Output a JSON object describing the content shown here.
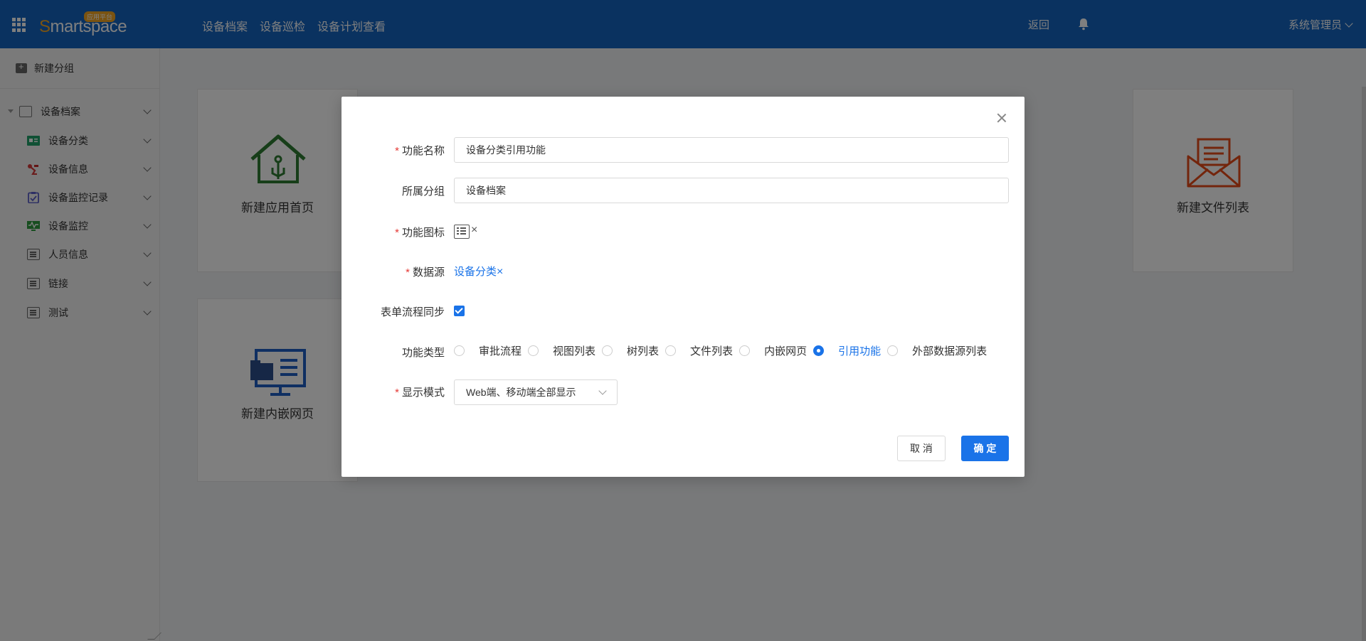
{
  "header": {
    "logo": "Smartspace",
    "logo_badge": "应用平台",
    "nav": [
      "设备档案",
      "设备巡检",
      "设备计划查看"
    ],
    "back": "返回",
    "user": "系统管理员"
  },
  "sidebar": {
    "new_group": "新建分组",
    "root": "设备档案",
    "items": [
      {
        "label": "设备分类",
        "icon": "category-card-icon"
      },
      {
        "label": "设备信息",
        "icon": "robot-arm-icon"
      },
      {
        "label": "设备监控记录",
        "icon": "clipboard-icon"
      },
      {
        "label": "设备监控",
        "icon": "monitor-chart-icon"
      },
      {
        "label": "人员信息",
        "icon": "list-icon"
      },
      {
        "label": "链接",
        "icon": "list-icon"
      },
      {
        "label": "测试",
        "icon": "list-icon"
      }
    ]
  },
  "cards": {
    "home": "新建应用首页",
    "file_list": "新建文件列表",
    "embed": "新建内嵌网页"
  },
  "modal": {
    "fields": {
      "name_label": "功能名称",
      "name_value": "设备分类引用功能",
      "group_label": "所属分组",
      "group_value": "设备档案",
      "icon_label": "功能图标",
      "source_label": "数据源",
      "source_value": "设备分类",
      "sync_label": "表单流程同步",
      "type_label": "功能类型",
      "mode_label": "显示模式",
      "mode_value": "Web端、移动端全部显示"
    },
    "types": [
      {
        "label": "审批流程",
        "checked": false
      },
      {
        "label": "视图列表",
        "checked": false
      },
      {
        "label": "树列表",
        "checked": false
      },
      {
        "label": "文件列表",
        "checked": false
      },
      {
        "label": "内嵌网页",
        "checked": false
      },
      {
        "label": "引用功能",
        "checked": true
      },
      {
        "label": "外部数据源列表",
        "checked": false
      }
    ],
    "remove_mark": "×",
    "cancel": "取 消",
    "ok": "确 定"
  },
  "colors": {
    "header_bg": "#1565c0",
    "primary": "#1a73e8",
    "required": "#e53935"
  }
}
